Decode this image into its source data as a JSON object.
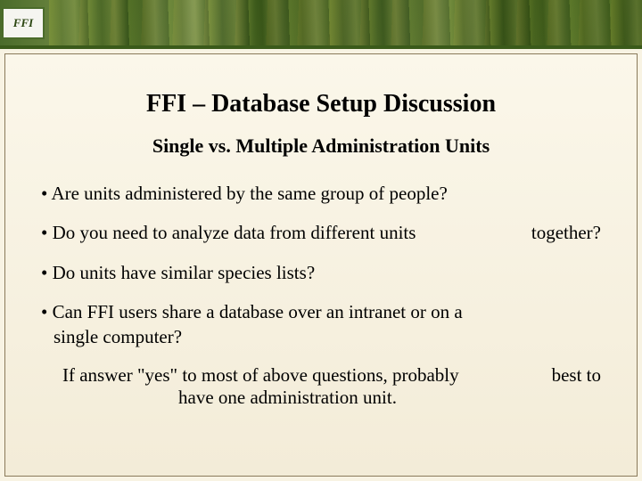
{
  "header": {
    "logo_text": "FFI"
  },
  "content": {
    "title": "FFI – Database Setup Discussion",
    "subtitle": "Single vs. Multiple Administration Units",
    "bullets": [
      {
        "text": "• Are units administered by the same group of people?",
        "trail": ""
      },
      {
        "text": "• Do you need to analyze data from different units",
        "trail": "together?"
      },
      {
        "text": "• Do units have similar species lists?",
        "trail": ""
      },
      {
        "text": "• Can FFI users share a database over an intranet or on a",
        "text2": "single computer?",
        "trail": ""
      }
    ],
    "conclusion": {
      "line1": "If answer \"yes\" to most of above questions, probably",
      "line2": "have one administration unit.",
      "trail": "best to"
    }
  }
}
